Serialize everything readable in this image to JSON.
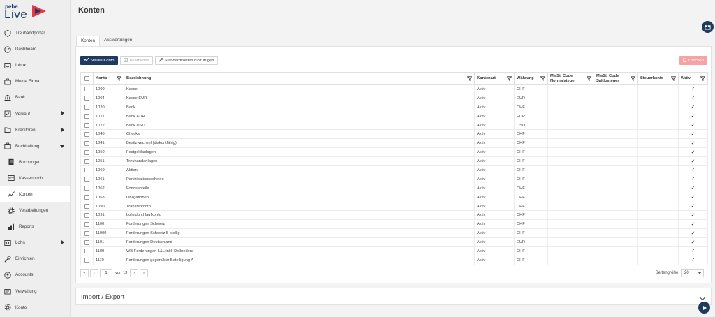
{
  "logo": {
    "top": "pebe",
    "brand": "Live"
  },
  "sidebar": {
    "items": [
      {
        "label": "Treuhandportal",
        "icon": "shield-icon",
        "sub": false,
        "caret": ""
      },
      {
        "label": "Dashboard",
        "icon": "dashboard-icon",
        "sub": false,
        "caret": ""
      },
      {
        "label": "Inbox",
        "icon": "inbox-icon",
        "sub": false,
        "caret": ""
      },
      {
        "label": "Meine Firma",
        "icon": "company-icon",
        "sub": false,
        "caret": ""
      },
      {
        "label": "Bank",
        "icon": "bank-icon",
        "sub": false,
        "caret": ""
      },
      {
        "label": "Verkauf",
        "icon": "sales-icon",
        "sub": false,
        "caret": "right"
      },
      {
        "label": "Kreditoren",
        "icon": "creditors-icon",
        "sub": false,
        "caret": "right"
      },
      {
        "label": "Buchhaltung",
        "icon": "accounting-icon",
        "sub": false,
        "caret": "down"
      },
      {
        "label": "Buchungen",
        "icon": "bookings-icon",
        "sub": true,
        "caret": ""
      },
      {
        "label": "Kassenbuch",
        "icon": "cashbook-icon",
        "sub": true,
        "caret": ""
      },
      {
        "label": "Konten",
        "icon": "chart-line-icon",
        "sub": true,
        "caret": "",
        "active": true
      },
      {
        "label": "Verarbeitungen",
        "icon": "gear-icon",
        "sub": true,
        "caret": ""
      },
      {
        "label": "Reports",
        "icon": "bar-chart-icon",
        "sub": true,
        "caret": ""
      },
      {
        "label": "Lohn",
        "icon": "payroll-icon",
        "sub": false,
        "caret": "right"
      },
      {
        "label": "Einrichten",
        "icon": "wrench-icon",
        "sub": false,
        "caret": ""
      },
      {
        "label": "Accounts",
        "icon": "accounts-icon",
        "sub": false,
        "caret": ""
      },
      {
        "label": "Verwaltung",
        "icon": "admin-icon",
        "sub": false,
        "caret": ""
      },
      {
        "label": "Konto",
        "icon": "settings-icon",
        "sub": false,
        "caret": ""
      }
    ]
  },
  "page": {
    "title": "Konten"
  },
  "tabs": [
    {
      "label": "Konten",
      "active": true
    },
    {
      "label": "Auswertungen",
      "active": false
    }
  ],
  "toolbar": {
    "new_label": "Neues Konto",
    "edit_label": "Bearbeiten",
    "std_label": "Standardkonten hinzufügen",
    "delete_label": "Löschen"
  },
  "table": {
    "headers": {
      "konto": "Konto",
      "bezeichnung": "Bezeichnung",
      "kontenart": "Kontenart",
      "waehrung": "Währung",
      "mwst_normal": "MwSt. Code Normalsteuer",
      "mwst_saldo": "MwSt. Code Saldosteuer",
      "steuerkonto": "Steuerkonto",
      "aktiv": "Aktiv"
    },
    "rows": [
      {
        "konto": "1000",
        "bez": "Kasse",
        "art": "Aktiv",
        "cur": "CHF"
      },
      {
        "konto": "1004",
        "bez": "Kasse EUR",
        "art": "Aktiv",
        "cur": "EUR"
      },
      {
        "konto": "1020",
        "bez": "Bank",
        "art": "Aktiv",
        "cur": "CHF"
      },
      {
        "konto": "1021",
        "bez": "Bank EUR",
        "art": "Aktiv",
        "cur": "EUR"
      },
      {
        "konto": "1022",
        "bez": "Bank USD",
        "art": "Aktiv",
        "cur": "USD"
      },
      {
        "konto": "1040",
        "bez": "Checks",
        "art": "Aktiv",
        "cur": "CHF"
      },
      {
        "konto": "1041",
        "bez": "Besitzwechsel (diskontfähig)",
        "art": "Aktiv",
        "cur": "CHF"
      },
      {
        "konto": "1050",
        "bez": "Festgeldanlagen",
        "art": "Aktiv",
        "cur": "CHF"
      },
      {
        "konto": "1051",
        "bez": "Treuhandanlagen",
        "art": "Aktiv",
        "cur": "CHF"
      },
      {
        "konto": "1060",
        "bez": "Aktien",
        "art": "Aktiv",
        "cur": "CHF"
      },
      {
        "konto": "1061",
        "bez": "Partizipationsscheine",
        "art": "Aktiv",
        "cur": "CHF"
      },
      {
        "konto": "1062",
        "bez": "Fondsanteile",
        "art": "Aktiv",
        "cur": "CHF"
      },
      {
        "konto": "1063",
        "bez": "Obligationen",
        "art": "Aktiv",
        "cur": "CHF"
      },
      {
        "konto": "1090",
        "bez": "Transferkonto",
        "art": "Aktiv",
        "cur": "CHF"
      },
      {
        "konto": "1091",
        "bez": "Lohndurchlaufkonto",
        "art": "Aktiv",
        "cur": "CHF"
      },
      {
        "konto": "1100",
        "bez": "Forderungen Schweiz",
        "art": "Aktiv",
        "cur": "CHF"
      },
      {
        "konto": "11000",
        "bez": "Forderungen Schweiz 5-stellig",
        "art": "Aktiv",
        "cur": "CHF"
      },
      {
        "konto": "1101",
        "bez": "Forderungen Deutschland",
        "art": "Aktiv",
        "cur": "EUR"
      },
      {
        "konto": "1109",
        "bez": "WB Forderungen L&L inkl. Delkredere",
        "art": "Aktiv",
        "cur": "CHF"
      },
      {
        "konto": "1110",
        "bez": "Forderungen gegenüber Beteiligung A",
        "art": "Aktiv",
        "cur": "CHF"
      }
    ]
  },
  "pager": {
    "page": "1",
    "of_text": "von 13",
    "size_label": "Seitengröße:",
    "size_value": "20"
  },
  "import_export": {
    "title": "Import / Export"
  },
  "colors": {
    "brand": "#1e3a5f",
    "accent_red": "#e63946",
    "delete": "#f5a3a3"
  }
}
